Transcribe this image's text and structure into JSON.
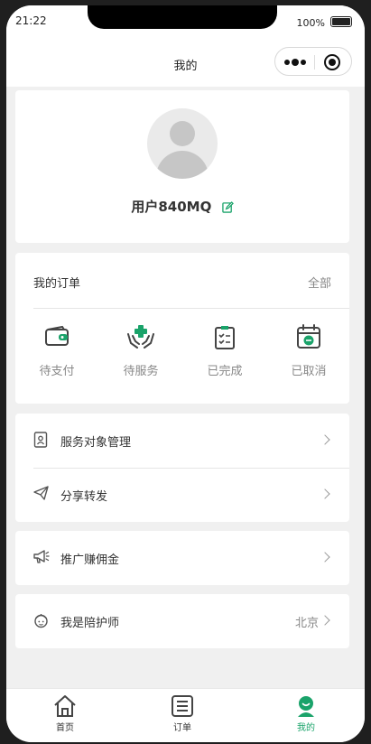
{
  "status_bar": {
    "time": "21:22",
    "battery": "100%"
  },
  "nav": {
    "title": "我的"
  },
  "profile": {
    "username": "用户840MQ"
  },
  "orders": {
    "title": "我的订单",
    "all_label": "全部",
    "items": [
      {
        "label": "待支付",
        "icon": "wallet-icon"
      },
      {
        "label": "待服务",
        "icon": "care-hands-icon"
      },
      {
        "label": "已完成",
        "icon": "clipboard-check-icon"
      },
      {
        "label": "已取消",
        "icon": "calendar-cancel-icon"
      }
    ]
  },
  "menu": {
    "service_targets": "服务对象管理",
    "share": "分享转发",
    "promote": "推广赚佣金",
    "caregiver": "我是陪护师",
    "caregiver_city": "北京"
  },
  "tabbar": {
    "items": [
      {
        "label": "首页",
        "icon": "home-icon"
      },
      {
        "label": "订单",
        "icon": "list-icon"
      },
      {
        "label": "我的",
        "icon": "user-icon"
      }
    ],
    "active_index": 2
  },
  "colors": {
    "accent": "#1aa36a",
    "page_bg": "#f0f0f0",
    "card_bg": "#ffffff"
  }
}
